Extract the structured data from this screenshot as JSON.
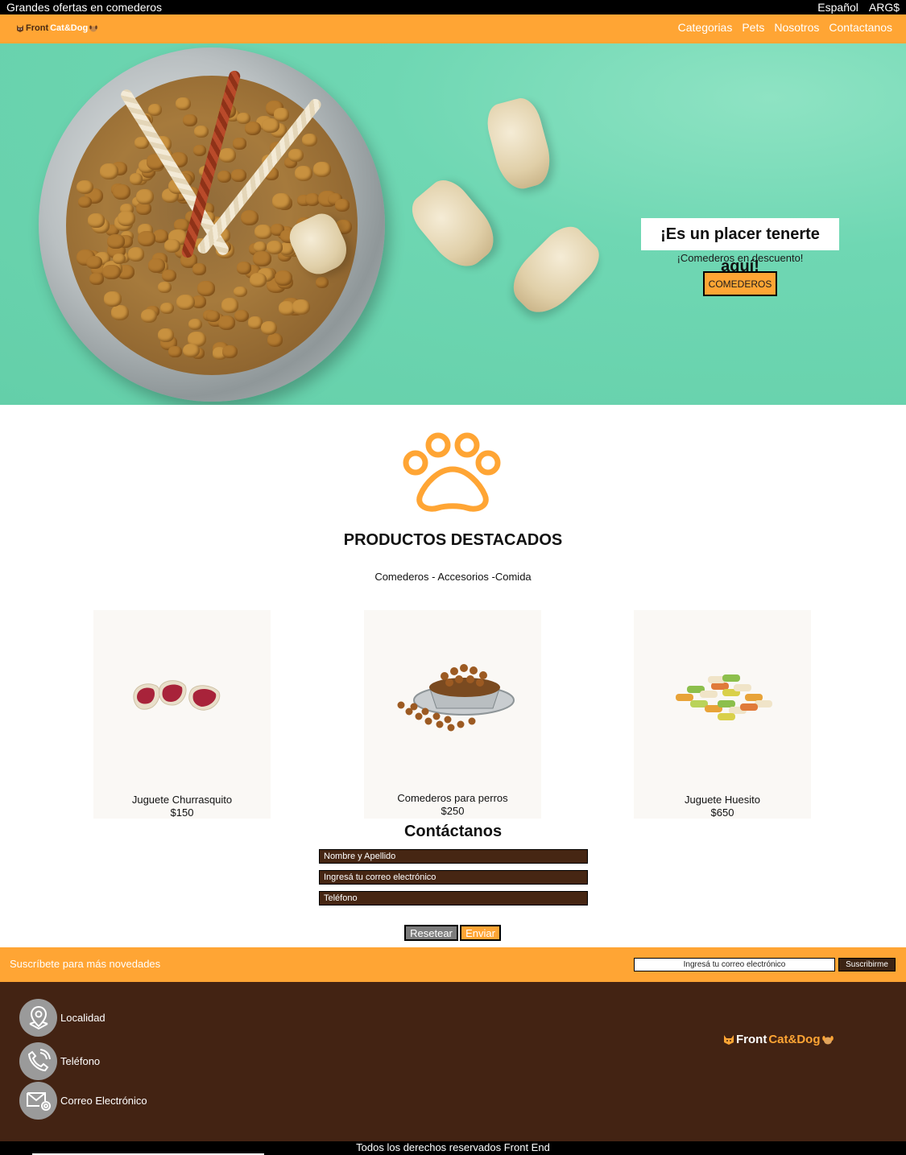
{
  "topbar": {
    "promo": "Grandes ofertas en comederos",
    "language": "Español",
    "currency": "ARG$"
  },
  "brand": {
    "part1": "Front",
    "part2": "Cat&Dog"
  },
  "nav": {
    "items": [
      "Categorias",
      "Pets",
      "Nosotros",
      "Contactanos"
    ]
  },
  "hero": {
    "title": "¡Es un placer tenerte aquí!",
    "subtitle": "¡Comederos en descuento!",
    "button": "COMEDEROS"
  },
  "featured": {
    "title": "PRODUCTOS DESTACADOS",
    "subtitle": "Comederos - Accesorios -Comida",
    "products": [
      {
        "name": "Juguete Churrasquito",
        "price": "$150"
      },
      {
        "name": "Comederos para perros",
        "price": "$250"
      },
      {
        "name": "Juguete Huesito",
        "price": "$650"
      }
    ]
  },
  "contact": {
    "title": "Contáctanos",
    "name_placeholder": "Nombre y Apellido",
    "email_placeholder": "Ingresá tu correo electrónico",
    "phone_placeholder": "Teléfono",
    "reset": "Resetear",
    "send": "Enviar"
  },
  "subscribe": {
    "label": "Suscríbete para más novedades",
    "placeholder": "Ingresá tu correo electrónico",
    "button": "Suscribirme"
  },
  "footer": {
    "items": [
      {
        "label": "Localidad",
        "icon": "location-pin-icon"
      },
      {
        "label": "Teléfono",
        "icon": "phone-icon"
      },
      {
        "label": "Correo Electrónico",
        "icon": "email-icon"
      }
    ],
    "copyright": "Todos los derechos reservados Front End"
  },
  "colors": {
    "accent": "#ffa534",
    "footer_bg": "#432313",
    "hero_bg": "#6fd7b3"
  }
}
